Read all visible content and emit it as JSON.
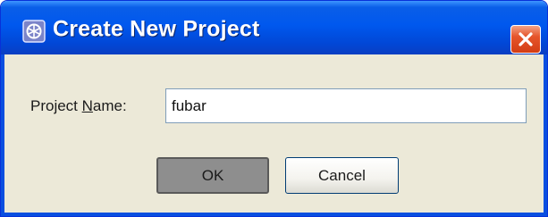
{
  "dialog": {
    "title": "Create New Project",
    "title_icon": "application-icon",
    "close_icon": "close-icon"
  },
  "form": {
    "project_name_label_prefix": "Project ",
    "project_name_label_mnemonic": "N",
    "project_name_label_suffix": "ame:",
    "project_name_value": "fubar"
  },
  "buttons": {
    "ok_label": "OK",
    "cancel_label": "Cancel"
  },
  "colors": {
    "titlebar_blue": "#0058ee",
    "close_red": "#e6552b",
    "dialog_background": "#ece9d8",
    "ok_button_gray": "#8e8e8e"
  }
}
